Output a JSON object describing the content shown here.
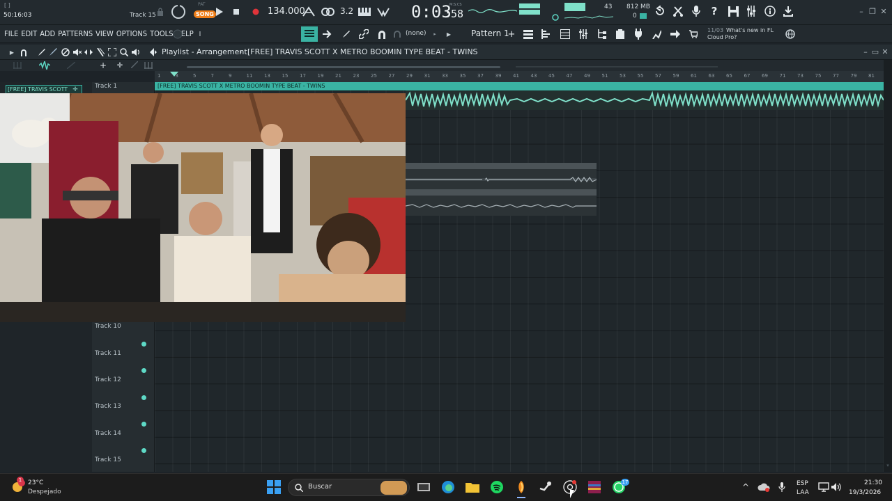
{
  "topbar": {
    "time_elapsed": "50:16:03",
    "hint_track": "Track 15",
    "mode_label": "SONG",
    "mode_alt_label": "PAT",
    "tempo": "134.000",
    "beat_display": "3.2",
    "time_display": "0:03",
    "time_display_small": ":58",
    "time_unit_label": "M:S:CS",
    "cpu_value": "43",
    "ram_value": "812 MB",
    "poly_value": "0"
  },
  "menu": {
    "items": [
      "FILE",
      "EDIT",
      "ADD",
      "PATTERNS",
      "VIEW",
      "OPTIONS",
      "TOOLS",
      "HELP"
    ],
    "snap_label": "(none)",
    "pattern_label": "Pattern 1",
    "news_date": "11/03",
    "news_text_line1": "What's new in FL",
    "news_text_line2": "Cloud Pro?"
  },
  "playlist": {
    "breadcrumb": "Playlist - Arrangement",
    "project_title": "[FREE] TRAVIS SCOTT X METRO BOOMIN TYPE BEAT - TWINS",
    "clip_name": "[FREE] TRAVIS SCOTT X METRO BOOMIN TYPE BEAT - TWINS",
    "picker_item": "[FREE] TRAVIS SCOTT...",
    "ruler_ticks": [
      "1",
      "3",
      "5",
      "7",
      "9",
      "11",
      "13",
      "15",
      "17",
      "19",
      "21",
      "23",
      "25",
      "27",
      "29",
      "31",
      "33",
      "35",
      "37",
      "39",
      "41",
      "43",
      "45",
      "47",
      "49",
      "51",
      "53",
      "55",
      "57",
      "59",
      "61",
      "63",
      "65",
      "67",
      "69",
      "71",
      "73",
      "75",
      "77",
      "79",
      "81"
    ],
    "tracks": [
      {
        "label": "Track 1"
      },
      {
        "label": "Track 10"
      },
      {
        "label": "Track 11"
      },
      {
        "label": "Track 12"
      },
      {
        "label": "Track 13"
      },
      {
        "label": "Track 14"
      },
      {
        "label": "Track 15"
      }
    ]
  },
  "taskbar": {
    "weather_temp": "23°C",
    "weather_desc": "Despejado",
    "search_placeholder": "Buscar",
    "lang_line1": "ESP",
    "lang_line2": "LAA",
    "clock_time": "21:30",
    "clock_date": "19/3/2026",
    "whatsapp_badge": "17"
  },
  "colors": {
    "accent": "#3ab3a3",
    "waveform": "#7fe0c9",
    "background": "#1d2328"
  }
}
